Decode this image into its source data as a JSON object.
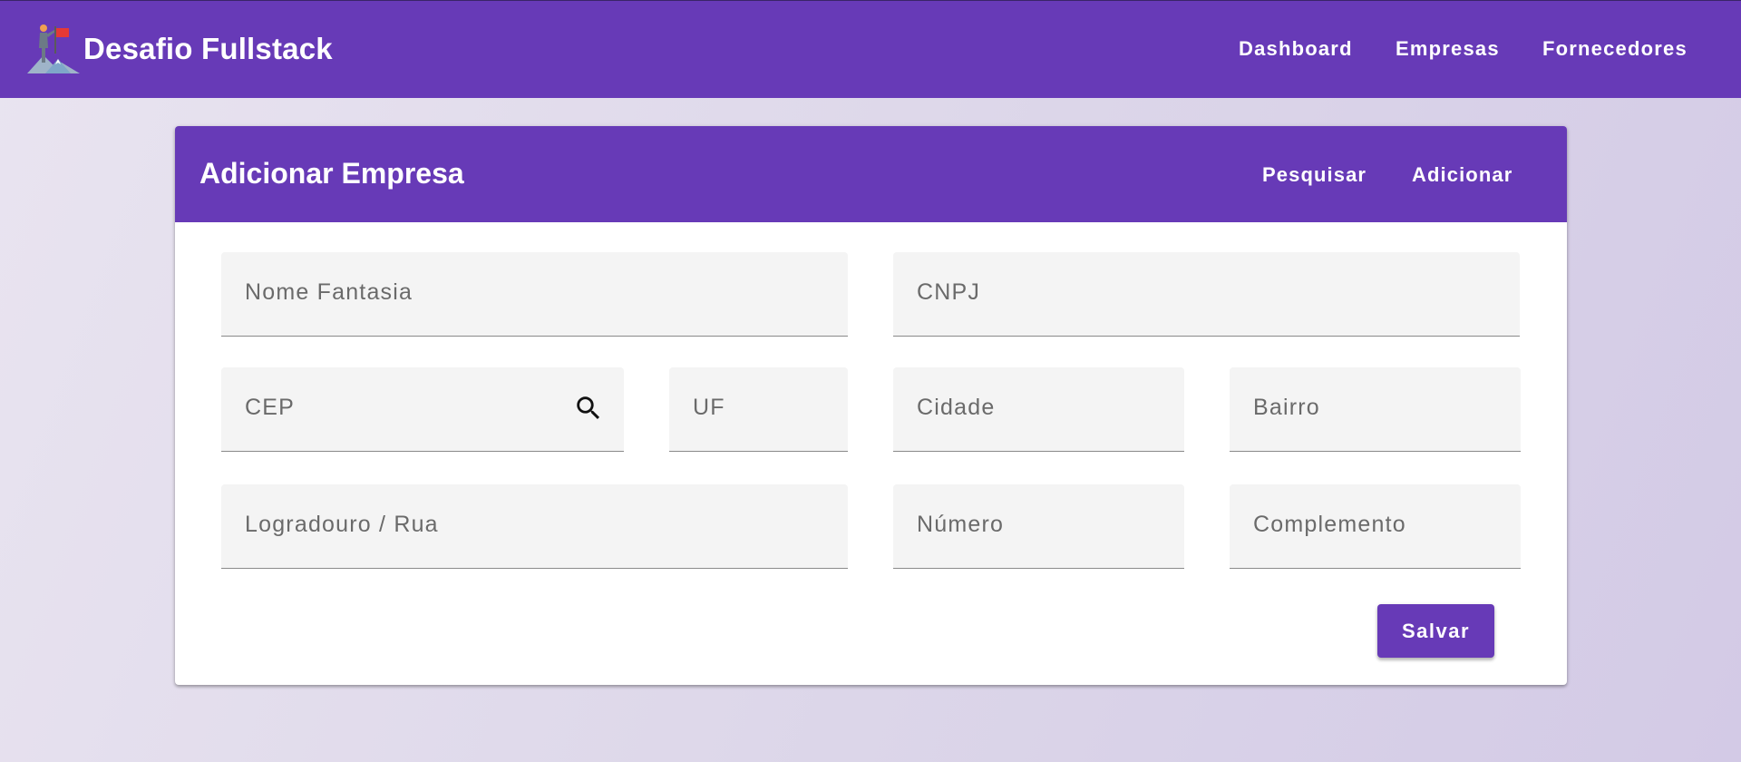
{
  "app": {
    "title": "Desafio Fullstack",
    "logo_icon": "climber-flag-logo-icon"
  },
  "nav": {
    "items": [
      {
        "label": "Dashboard"
      },
      {
        "label": "Empresas"
      },
      {
        "label": "Fornecedores"
      }
    ]
  },
  "form": {
    "title": "Adicionar Empresa",
    "actions": [
      {
        "label": "Pesquisar"
      },
      {
        "label": "Adicionar"
      }
    ],
    "fields": {
      "nome_fantasia": {
        "label": "Nome Fantasia",
        "value": ""
      },
      "cnpj": {
        "label": "CNPJ",
        "value": ""
      },
      "cep": {
        "label": "CEP",
        "value": "",
        "icon": "search-icon"
      },
      "uf": {
        "label": "UF",
        "value": ""
      },
      "cidade": {
        "label": "Cidade",
        "value": ""
      },
      "bairro": {
        "label": "Bairro",
        "value": ""
      },
      "logradouro": {
        "label": "Logradouro / Rua",
        "value": ""
      },
      "numero": {
        "label": "Número",
        "value": ""
      },
      "complemento": {
        "label": "Complemento",
        "value": ""
      }
    },
    "submit_label": "Salvar"
  },
  "colors": {
    "primary": "#673ab7",
    "field_bg": "#f4f4f4",
    "background_start": "#e9e4f0",
    "background_end": "#d3cae6"
  }
}
